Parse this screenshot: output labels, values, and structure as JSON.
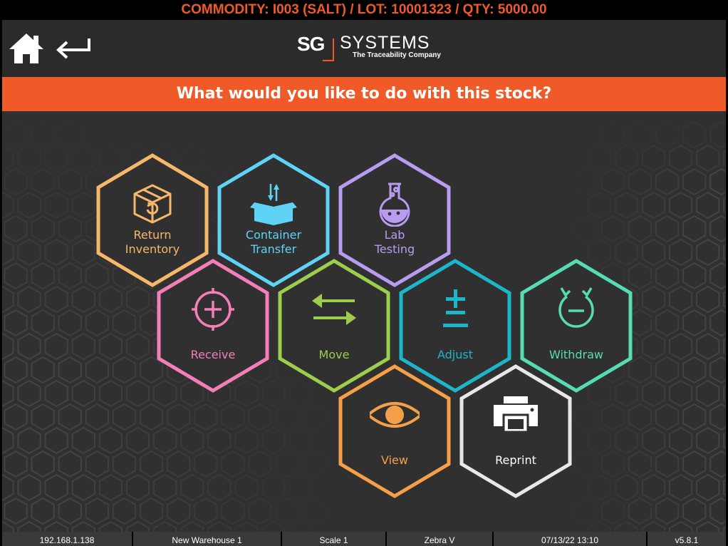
{
  "topbar": {
    "text": "COMMODITY: I003 (SALT) / LOT: 10001323 / QTY: 5000.00"
  },
  "header": {
    "home_icon": "home-icon",
    "back_icon": "back-arrow-icon",
    "logo": {
      "mark": "SG",
      "name": "SYSTEMS",
      "tagline": "The Traceability Company"
    }
  },
  "banner": {
    "text": "What would you like to do with this stock?"
  },
  "colors": {
    "accent": "#f05a28",
    "background": "#303030",
    "return": "#f7b76b",
    "container": "#5fd3f5",
    "lab": "#b89cf2",
    "receive": "#f37eb8",
    "move": "#9ccd4d",
    "adjust": "#1db6c9",
    "withdraw": "#57dbb5",
    "view": "#f5a048",
    "reprint": "#e8e8e8"
  },
  "actions": [
    {
      "id": "return-inventory",
      "line1": "Return",
      "line2": "Inventory",
      "icon": "box-return-icon"
    },
    {
      "id": "container-transfer",
      "line1": "Container",
      "line2": "Transfer",
      "icon": "box-transfer-icon"
    },
    {
      "id": "lab-testing",
      "line1": "Lab",
      "line2": "Testing",
      "icon": "flask-icon"
    },
    {
      "id": "receive",
      "line1": "Receive",
      "line2": "",
      "icon": "target-plus-icon"
    },
    {
      "id": "move",
      "line1": "Move",
      "line2": "",
      "icon": "swap-arrows-icon"
    },
    {
      "id": "adjust",
      "line1": "Adjust",
      "line2": "",
      "icon": "plus-minus-icon"
    },
    {
      "id": "withdraw",
      "line1": "Withdraw",
      "line2": "",
      "icon": "withdraw-icon"
    },
    {
      "id": "view",
      "line1": "View",
      "line2": "",
      "icon": "eye-icon"
    },
    {
      "id": "reprint",
      "line1": "Reprint",
      "line2": "",
      "icon": "printer-icon"
    }
  ],
  "status": {
    "ip": "192.168.1.138",
    "warehouse": "New Warehouse 1",
    "scale": "Scale 1",
    "printer": "Zebra V",
    "datetime": "07/13/22 13:10",
    "version": "v5.8.1"
  }
}
